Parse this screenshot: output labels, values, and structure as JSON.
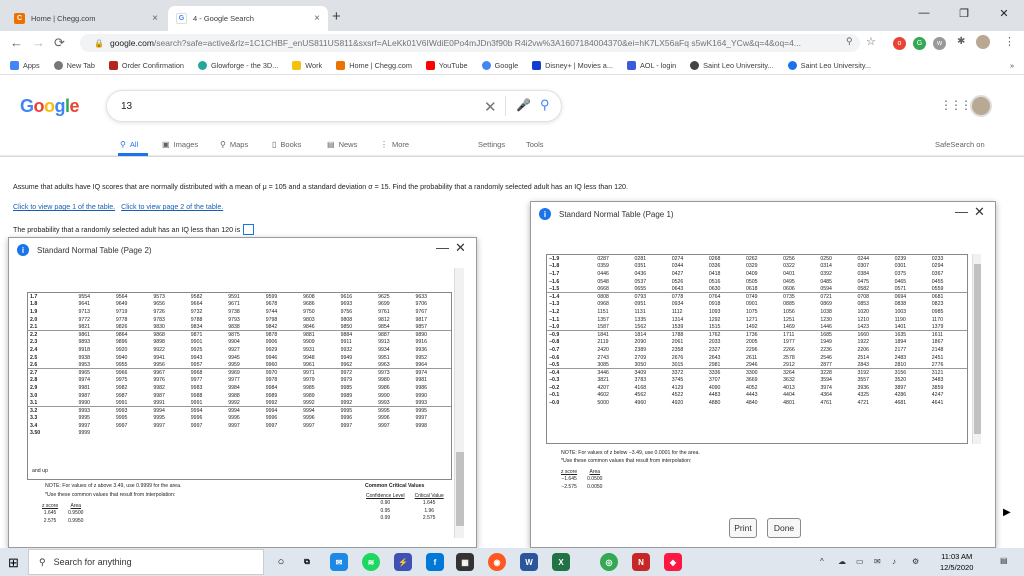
{
  "browser": {
    "tabs": [
      {
        "label": "Home | Chegg.com",
        "close": "×",
        "favicon": "C"
      },
      {
        "label": "4 - Google Search",
        "close": "×",
        "favicon": "G"
      }
    ],
    "new_tab": "+",
    "window": {
      "minimize": "—",
      "maximize": "❐",
      "close": "✕"
    },
    "nav": {
      "back": "←",
      "forward": "→",
      "reload": "⟳"
    },
    "url_host": "google.com",
    "url_rest": "/search?safe=active&rlz=1C1CHBF_enUS811US811&sxsrf=ALeKk01V6IWdiE0Po4mJDn3f90b R4i2vw%3A1607184004370&ei=hK7LX56aFq s5wK164_YCw&q=4&oq=4...",
    "bookmarks": [
      "Apps",
      "New Tab",
      "Order Confirmation",
      "Glowforge - the 3D...",
      "Work",
      "Home | Chegg.com",
      "YouTube",
      "Google",
      "Disney+ | Movies a...",
      "AOL - login",
      "Saint Leo University...",
      "Saint Leo University..."
    ],
    "bookmarks_more": "»"
  },
  "google": {
    "logo": "Google",
    "query": "13",
    "tabs": [
      "All",
      "Images",
      "Maps",
      "Books",
      "News",
      "More"
    ],
    "settings": "Settings",
    "tools": "Tools",
    "safesearch": "SafeSearch on"
  },
  "problem": {
    "question": "Assume that adults have IQ scores that are normally distributed with a mean of μ = 105 and a standard deviation σ = 15. Find the probability that a randomly selected adult has an IQ less than 120.",
    "link1": "Click to view page 1 of the table.",
    "link2": "Click to view page 2 of the table.",
    "answer_prompt": "The probability that a randomly selected adult has an IQ less than 120 is"
  },
  "table_page1": {
    "title": "Standard Normal Table (Page 1)",
    "rows": [
      [
        "−1.9",
        "0287",
        "0281",
        "0274",
        "0268",
        "0262",
        "0256",
        "0250",
        "0244",
        "0239",
        "0233"
      ],
      [
        "−1.8",
        "0359",
        "0351",
        "0344",
        "0336",
        "0329",
        "0322",
        "0314",
        "0307",
        "0301",
        "0294"
      ],
      [
        "−1.7",
        "0446",
        "0436",
        "0427",
        "0418",
        "0409",
        "0401",
        "0392",
        "0384",
        "0375",
        "0367"
      ],
      [
        "−1.6",
        "0548",
        "0537",
        "0526",
        "0516",
        "0505",
        "0495",
        "0485",
        "0475",
        "0465",
        "0455"
      ],
      [
        "−1.5",
        "0668",
        "0655",
        "0643",
        "0630",
        "0618",
        "0606",
        "0594",
        "0582",
        "0571",
        "0559"
      ],
      [
        "−1.4",
        "0808",
        "0793",
        "0778",
        "0764",
        "0749",
        "0735",
        "0721",
        "0708",
        "0694",
        "0681"
      ],
      [
        "−1.3",
        "0968",
        "0951",
        "0934",
        "0918",
        "0901",
        "0885",
        "0869",
        "0853",
        "0838",
        "0823"
      ],
      [
        "−1.2",
        "1151",
        "1131",
        "1112",
        "1093",
        "1075",
        "1056",
        "1038",
        "1020",
        "1003",
        "0985"
      ],
      [
        "−1.1",
        "1357",
        "1335",
        "1314",
        "1292",
        "1271",
        "1251",
        "1230",
        "1210",
        "1190",
        "1170"
      ],
      [
        "−1.0",
        "1587",
        "1562",
        "1539",
        "1515",
        "1492",
        "1469",
        "1446",
        "1423",
        "1401",
        "1379"
      ],
      [
        "−0.9",
        "1841",
        "1814",
        "1788",
        "1762",
        "1736",
        "1711",
        "1685",
        "1660",
        "1635",
        "1611"
      ],
      [
        "−0.8",
        "2119",
        "2090",
        "2061",
        "2033",
        "2005",
        "1977",
        "1949",
        "1922",
        "1894",
        "1867"
      ],
      [
        "−0.7",
        "2420",
        "2389",
        "2358",
        "2327",
        "2296",
        "2266",
        "2236",
        "2206",
        "2177",
        "2148"
      ],
      [
        "−0.6",
        "2743",
        "2709",
        "2676",
        "2643",
        "2611",
        "2578",
        "2546",
        "2514",
        "2483",
        "2451"
      ],
      [
        "−0.5",
        "3085",
        "3050",
        "3015",
        "2981",
        "2946",
        "2912",
        "2877",
        "2843",
        "2810",
        "2776"
      ],
      [
        "−0.4",
        "3446",
        "3409",
        "3372",
        "3336",
        "3300",
        "3264",
        "3228",
        "3192",
        "3156",
        "3121"
      ],
      [
        "−0.3",
        "3821",
        "3783",
        "3745",
        "3707",
        "3669",
        "3632",
        "3594",
        "3557",
        "3520",
        "3483"
      ],
      [
        "−0.2",
        "4207",
        "4168",
        "4129",
        "4090",
        "4052",
        "4013",
        "3974",
        "3936",
        "3897",
        "3859"
      ],
      [
        "−0.1",
        "4602",
        "4562",
        "4522",
        "4483",
        "4443",
        "4404",
        "4364",
        "4325",
        "4286",
        "4247"
      ],
      [
        "−0.0",
        "5000",
        "4960",
        "4920",
        "4880",
        "4840",
        "4801",
        "4761",
        "4721",
        "4681",
        "4641"
      ]
    ],
    "note1": "NOTE: For values of z below −3.49, use 0.0001 for the area.",
    "note2": "*Use these common values that result from interpolation:",
    "interp_head": [
      "z score",
      "Area"
    ],
    "interp_rows": [
      [
        "−1.645",
        "0.0500"
      ],
      [
        "−2.575",
        "0.0050"
      ]
    ]
  },
  "table_page2": {
    "title": "Standard Normal Table (Page 2)",
    "rows": [
      [
        "1.7",
        "9554",
        "9564",
        "9573",
        "9582",
        "9591",
        "9599",
        "9608",
        "9616",
        "9625",
        "9633"
      ],
      [
        "1.8",
        "9641",
        "9649",
        "9656",
        "9664",
        "9671",
        "9678",
        "9686",
        "9693",
        "9699",
        "9706"
      ],
      [
        "1.9",
        "9713",
        "9719",
        "9726",
        "9732",
        "9738",
        "9744",
        "9750",
        "9756",
        "9761",
        "9767"
      ],
      [
        "2.0",
        "9772",
        "9778",
        "9783",
        "9788",
        "9793",
        "9798",
        "9803",
        "9808",
        "9812",
        "9817"
      ],
      [
        "2.1",
        "9821",
        "9826",
        "9830",
        "9834",
        "9838",
        "9842",
        "9846",
        "9850",
        "9854",
        "9857"
      ],
      [
        "2.2",
        "9861",
        "9864",
        "9868",
        "9871",
        "9875",
        "9878",
        "9881",
        "9884",
        "9887",
        "9890"
      ],
      [
        "2.3",
        "9893",
        "9896",
        "9898",
        "9901",
        "9904",
        "9906",
        "9909",
        "9911",
        "9913",
        "9916"
      ],
      [
        "2.4",
        "9918",
        "9920",
        "9922",
        "9925",
        "9927",
        "9929",
        "9931",
        "9932",
        "9934",
        "9936"
      ],
      [
        "2.5",
        "9938",
        "9940",
        "9941",
        "9943",
        "9945",
        "9946",
        "9948",
        "9949",
        "9951",
        "9952"
      ],
      [
        "2.6",
        "9953",
        "9955",
        "9956",
        "9957",
        "9959",
        "9960",
        "9961",
        "9962",
        "9963",
        "9964"
      ],
      [
        "2.7",
        "9965",
        "9966",
        "9967",
        "9968",
        "9969",
        "9970",
        "9971",
        "9972",
        "9973",
        "9974"
      ],
      [
        "2.8",
        "9974",
        "9975",
        "9976",
        "9977",
        "9977",
        "9978",
        "9979",
        "9979",
        "9980",
        "9981"
      ],
      [
        "2.9",
        "9981",
        "9982",
        "9982",
        "9983",
        "9984",
        "9984",
        "9985",
        "9985",
        "9986",
        "9986"
      ],
      [
        "3.0",
        "9987",
        "9987",
        "9987",
        "9988",
        "9988",
        "9989",
        "9989",
        "9989",
        "9990",
        "9990"
      ],
      [
        "3.1",
        "9990",
        "9991",
        "9991",
        "9991",
        "9992",
        "9992",
        "9992",
        "9992",
        "9993",
        "9993"
      ],
      [
        "3.2",
        "9993",
        "9993",
        "9994",
        "9994",
        "9994",
        "9994",
        "9994",
        "9995",
        "9995",
        "9995"
      ],
      [
        "3.3",
        "9995",
        "9995",
        "9995",
        "9996",
        "9996",
        "9996",
        "9996",
        "9996",
        "9996",
        "9997"
      ],
      [
        "3.4",
        "9997",
        "9997",
        "9997",
        "9997",
        "9997",
        "9997",
        "9997",
        "9997",
        "9997",
        "9998"
      ],
      [
        "3.50",
        "9999",
        "",
        "",
        "",
        "",
        "",
        "",
        "",
        "",
        ""
      ]
    ],
    "last_row_label": "and up",
    "note1": "NOTE: For values of z above 3.49, use 0.9999 for the area.",
    "note2": "*Use these common values that result from interpolation:",
    "interp_head": [
      "z score",
      "Area"
    ],
    "interp_rows": [
      [
        "1.645",
        "0.9500"
      ],
      [
        "2.575",
        "0.9950"
      ]
    ],
    "crit_title": "Common Critical Values",
    "crit_head": [
      "Confidence Level",
      "Critical Value"
    ],
    "crit_rows": [
      [
        "0.90",
        "1.645"
      ],
      [
        "0.95",
        "1.96"
      ],
      [
        "0.99",
        "2.575"
      ]
    ]
  },
  "buttons": {
    "print": "Print",
    "done": "Done"
  },
  "taskbar": {
    "search": "Search for anything",
    "time": "11:03 AM",
    "date": "12/5/2020"
  }
}
